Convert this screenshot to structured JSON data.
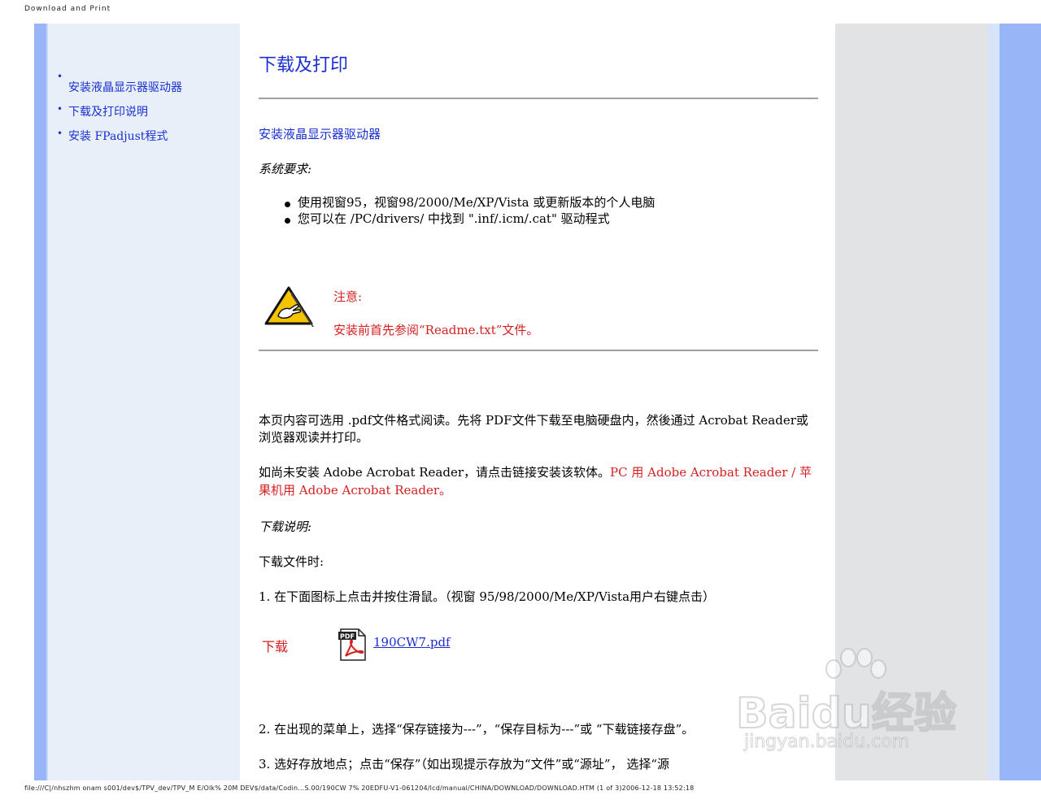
{
  "header": {
    "text": "Download and Print"
  },
  "footer": {
    "text": "file:///C|/nhszhm onam s001/dev$/TPV_dev/TPV_M E/Olk% 20M DEV$/data/Codin...S.00/190CW 7% 20EDFU-V1-061204/lcd/manual/CHINA/DOWNLOAD/DOWNLOAD.HTM  (1 of 3)2006-12-18 13:52:18"
  },
  "sidebar": {
    "items": [
      {
        "label": "安装液晶显示器驱动器"
      },
      {
        "label": "下载及打印说明"
      },
      {
        "label": "安装 FPadjust程式"
      }
    ]
  },
  "main": {
    "title": "下载及打印",
    "section_title": "安装液晶显示器驱动器",
    "sysreq_label": "系统要求:",
    "bullets": [
      "使用视窗95，视窗98/2000/Me/XP/Vista 或更新版本的个人电脑",
      "您可以在 /PC/drivers/ 中找到 \".inf/.icm/.cat\" 驱动程式"
    ],
    "note_label": "注意:",
    "note_text": "安装前首先参阅“Readme.txt”文件。",
    "para1": "本页内容可选用 .pdf文件格式阅读。先将 PDF文件下载至电脑硬盘内，然後通过 Acrobat Reader或浏览器观读并打印。",
    "para2_prefix": "如尚未安装 Adobe   Acrobat Reader，请点击链接安装该软体。",
    "para2_link_pc": "PC 用 Adobe   Acrobat Reader",
    "para2_sep": " / ",
    "para2_link_mac": "苹果机用 Adobe   Acrobat Reader",
    "para2_end": "。",
    "download_instructions": "下载说明:",
    "download_file_when": "下载文件时:",
    "step1": "1. 在下面图标上点击并按住滑鼠。（视窗 95/98/2000/Me/XP/Vista用户右键点击）",
    "download_label": "下载",
    "pdf_icon_label": "PDF",
    "pdf_filename": "190CW7.pdf",
    "step2": "2. 在出现的菜单上，选择“保存链接为---”，“保存目标为---”或 “下载链接存盘”。",
    "step3": "3. 选好存放地点；点击“保存”（如出现提示存放为“文件”或“源址”， 选择“源"
  },
  "watermark": {
    "text": "Baidu经验",
    "sub": "jingyan.baidu.com"
  },
  "colors": {
    "link_blue": "#1a2fcf",
    "alert_red": "#d42020",
    "stripe_blue": "#98b5f7",
    "sidebar_bg": "#e8eff8",
    "right_gray": "#e2e3e5"
  },
  "icons": {
    "note": "caution-hand-icon",
    "pdf": "pdf-file-icon"
  }
}
